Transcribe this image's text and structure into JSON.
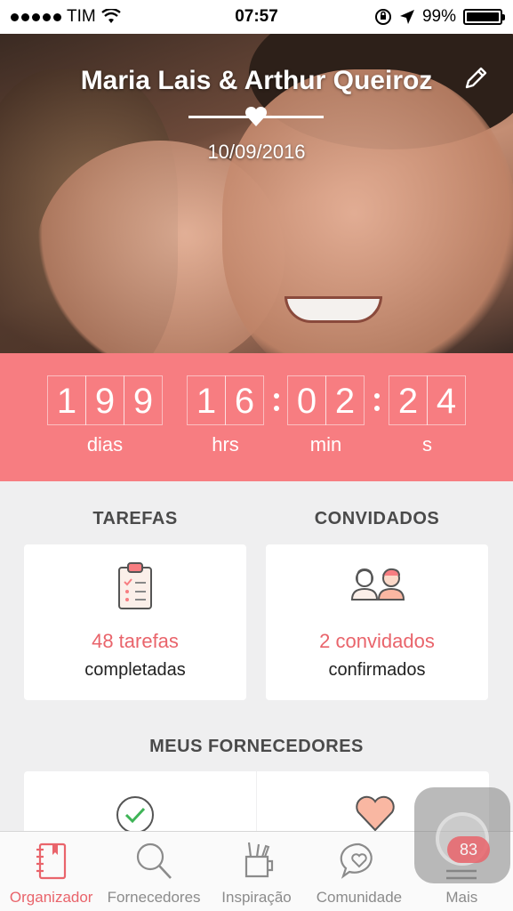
{
  "status_bar": {
    "carrier": "TIM",
    "time": "07:57",
    "battery": "99%",
    "battery_level": 0.99
  },
  "hero": {
    "couple_name": "Maria Lais & Arthur Queiroz",
    "wedding_date": "10/09/2016"
  },
  "countdown": {
    "days": [
      "1",
      "9",
      "9"
    ],
    "hours": [
      "1",
      "6"
    ],
    "minutes": [
      "0",
      "2"
    ],
    "seconds": [
      "2",
      "4"
    ],
    "labels": {
      "days": "dias",
      "hours": "hrs",
      "minutes": "min",
      "seconds": "s"
    }
  },
  "sections": {
    "tasks_title": "TAREFAS",
    "guests_title": "CONVIDADOS",
    "vendors_title": "MEUS FORNECEDORES"
  },
  "tasks_card": {
    "value": "48 tarefas",
    "sub": "completadas",
    "icon": "clipboard-icon"
  },
  "guests_card": {
    "value": "2 convidados",
    "sub": "confirmados",
    "icon": "guests-icon"
  },
  "vendors_cards": [
    {
      "icon": "check-circle-icon"
    },
    {
      "icon": "heart-icon"
    }
  ],
  "tabbar": {
    "items": [
      {
        "label": "Organizador",
        "icon": "notebook-icon",
        "active": true
      },
      {
        "label": "Fornecedores",
        "icon": "search-icon",
        "active": false
      },
      {
        "label": "Inspiração",
        "icon": "tools-cup-icon",
        "active": false
      },
      {
        "label": "Comunidade",
        "icon": "chat-heart-icon",
        "active": false
      },
      {
        "label": "Mais",
        "icon": "menu-icon",
        "active": false
      }
    ]
  },
  "more_badge": "83",
  "colors": {
    "accent": "#f77d81",
    "accent_text": "#e9646b",
    "background": "#efeff0"
  }
}
